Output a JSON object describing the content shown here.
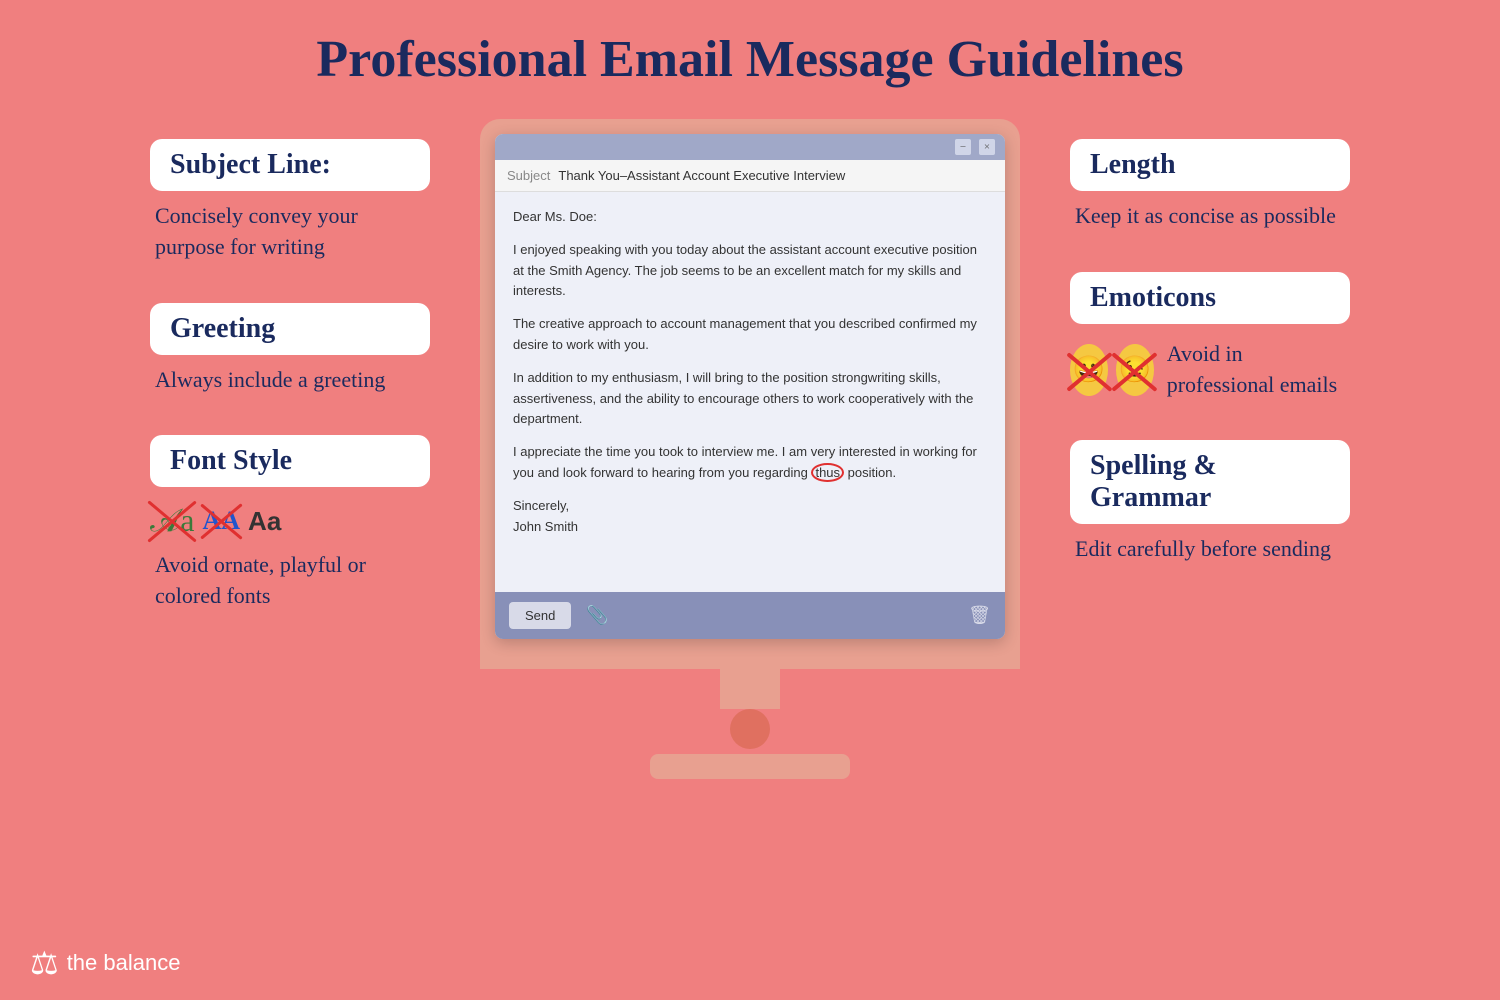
{
  "page": {
    "title": "Professional Email Message Guidelines",
    "background_color": "#f07f7f"
  },
  "left_panel": {
    "subject_line": {
      "label": "Subject Line:",
      "description": "Concisely convey your purpose for writing"
    },
    "greeting": {
      "label": "Greeting",
      "description": "Always include a greeting"
    },
    "font_style": {
      "label": "Font Style",
      "description": "Avoid ornate, playful or colored fonts"
    }
  },
  "right_panel": {
    "length": {
      "label": "Length",
      "description": "Keep it as concise as possible"
    },
    "emoticons": {
      "label": "Emoticons",
      "description": "Avoid in professional emails"
    },
    "spelling_grammar": {
      "label": "Spelling & Grammar",
      "description": "Edit carefully before sending"
    }
  },
  "email": {
    "subject": "Thank You–Assistant Account Executive Interview",
    "greeting": "Dear Ms. Doe:",
    "body_paragraphs": [
      "I enjoyed speaking with you today about the assistant account executive position at the Smith Agency. The job seems to be an excellent match for my skills and interests.",
      "The creative approach to account management that you described confirmed my desire to work with you.",
      "In addition to my enthusiasm, I will bring to the position strongwriting skills, assertiveness, and the ability to encourage others to work cooperatively with the department.",
      "I appreciate the time you took to interview me. I am very interested in working for you and look forward to hearing from you regarding thus position."
    ],
    "closing": "Sincerely,",
    "signature": "John Smith",
    "send_button": "Send"
  },
  "footer": {
    "brand": "the balance"
  },
  "icons": {
    "minimize": "−",
    "close": "×",
    "paperclip": "📎",
    "trash": "🗑"
  }
}
